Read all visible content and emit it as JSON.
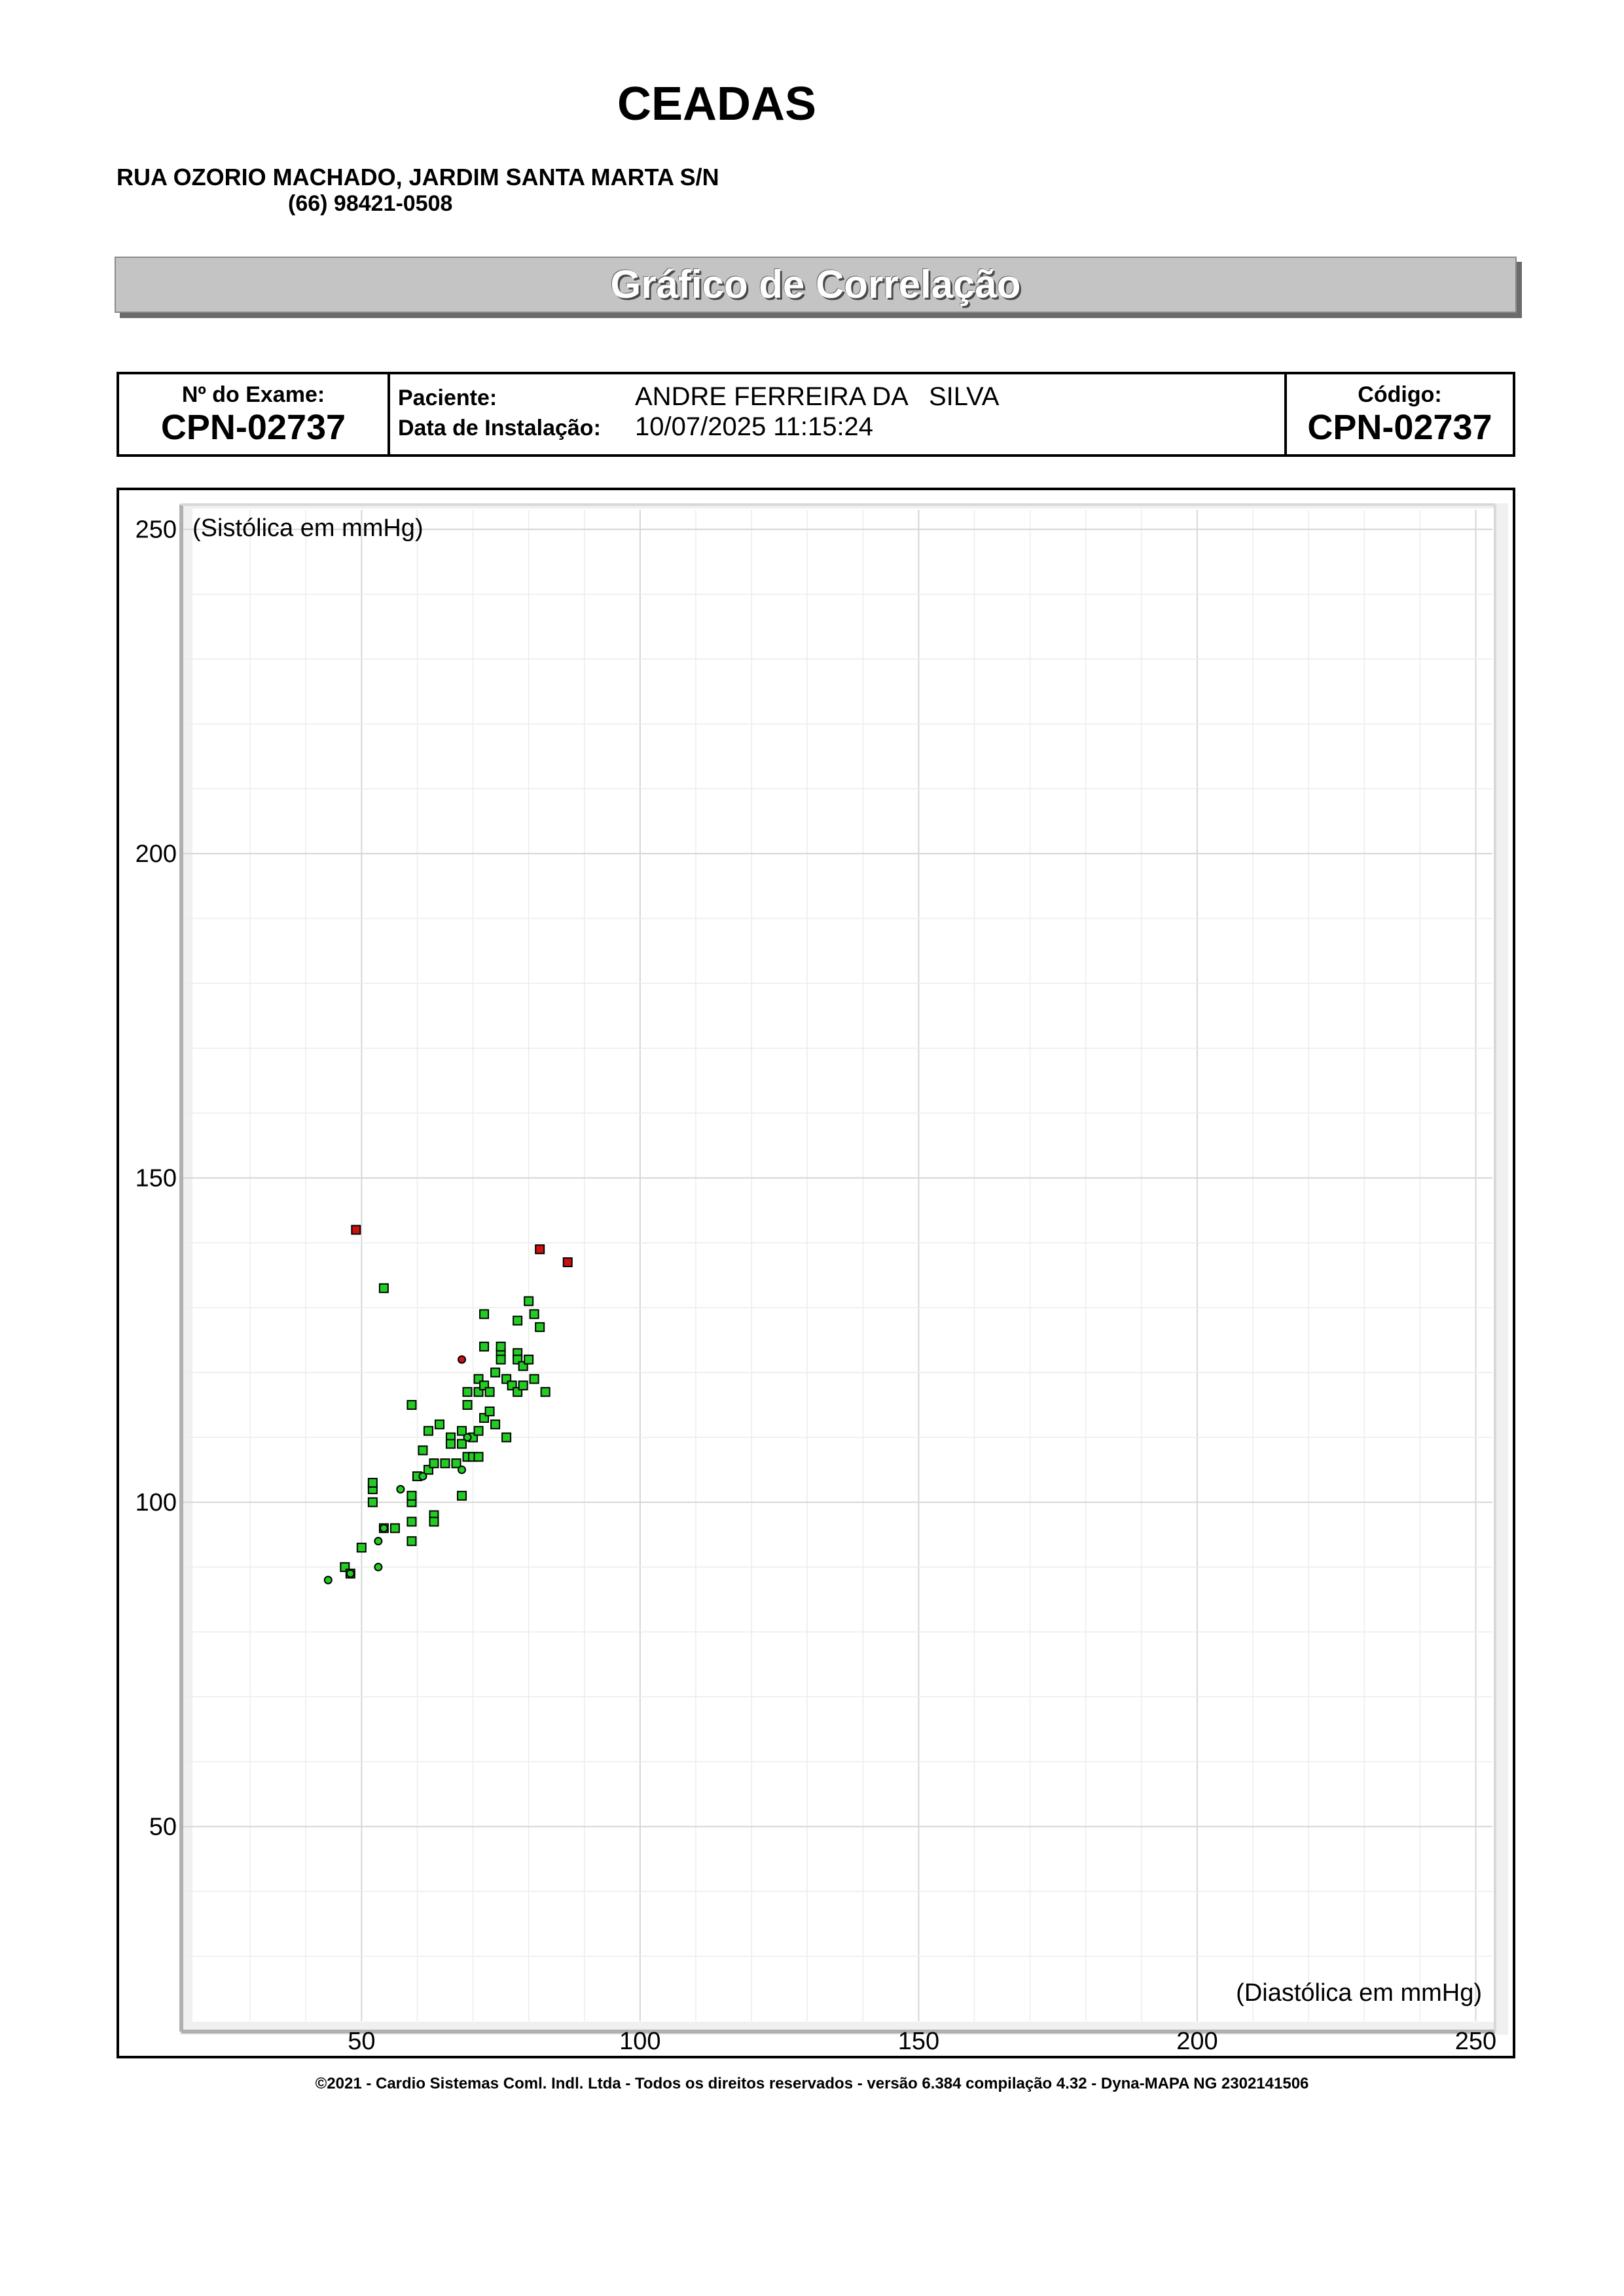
{
  "header": {
    "clinic_name": "CEADAS",
    "address": "RUA OZORIO MACHADO, JARDIM SANTA MARTA S/N",
    "phone": "(66) 98421-0508"
  },
  "banner": {
    "title": "Gráfico de Correlação"
  },
  "info": {
    "exam_label": "Nº do Exame:",
    "exam_value": "CPN-02737",
    "patient_label": "Paciente:",
    "patient_value": "ANDRE FERREIRA DA   SILVA",
    "install_label": "Data de Instalação:",
    "install_value": "10/07/2025 11:15:24",
    "code_label": "Código:",
    "code_value": "CPN-02737"
  },
  "chart_data": {
    "type": "scatter",
    "xlabel": "(Diastólica em mmHg)",
    "ylabel": "(Sistólica em mmHg)",
    "xlim": [
      18,
      253
    ],
    "ylim": [
      20,
      253
    ],
    "xticks": [
      50,
      100,
      150,
      200,
      250
    ],
    "yticks": [
      50,
      100,
      150,
      200,
      250
    ],
    "grid": true,
    "colors": {
      "normal": "#22cc22",
      "alert": "#cc1111",
      "grid": "#dddddd",
      "frame": "#b0b0b0"
    },
    "series": [
      {
        "marker": "square",
        "color": "#22cc22",
        "points": [
          [
            47,
            90
          ],
          [
            48,
            89
          ],
          [
            50,
            93
          ],
          [
            52,
            100
          ],
          [
            52,
            102
          ],
          [
            52,
            103
          ],
          [
            54,
            133
          ],
          [
            54,
            96
          ],
          [
            56,
            96
          ],
          [
            59,
            94
          ],
          [
            59,
            97
          ],
          [
            59,
            100
          ],
          [
            59,
            101
          ],
          [
            59,
            115
          ],
          [
            60,
            104
          ],
          [
            61,
            108
          ],
          [
            62,
            111
          ],
          [
            62,
            105
          ],
          [
            63,
            98
          ],
          [
            63,
            97
          ],
          [
            63,
            106
          ],
          [
            64,
            112
          ],
          [
            65,
            106
          ],
          [
            66,
            110
          ],
          [
            66,
            109
          ],
          [
            67,
            106
          ],
          [
            68,
            111
          ],
          [
            68,
            109
          ],
          [
            68,
            101
          ],
          [
            69,
            117
          ],
          [
            69,
            115
          ],
          [
            69,
            107
          ],
          [
            70,
            110
          ],
          [
            70,
            107
          ],
          [
            71,
            119
          ],
          [
            71,
            117
          ],
          [
            71,
            111
          ],
          [
            71,
            107
          ],
          [
            72,
            129
          ],
          [
            72,
            124
          ],
          [
            72,
            118
          ],
          [
            72,
            113
          ],
          [
            73,
            117
          ],
          [
            73,
            114
          ],
          [
            74,
            120
          ],
          [
            74,
            112
          ],
          [
            75,
            123
          ],
          [
            75,
            124
          ],
          [
            75,
            122
          ],
          [
            76,
            110
          ],
          [
            76,
            119
          ],
          [
            77,
            118
          ],
          [
            78,
            128
          ],
          [
            78,
            123
          ],
          [
            78,
            122
          ],
          [
            78,
            117
          ],
          [
            79,
            121
          ],
          [
            79,
            118
          ],
          [
            80,
            131
          ],
          [
            80,
            122
          ],
          [
            81,
            129
          ],
          [
            81,
            119
          ],
          [
            82,
            127
          ],
          [
            83,
            117
          ]
        ]
      },
      {
        "marker": "circle",
        "color": "#22cc22",
        "points": [
          [
            44,
            88
          ],
          [
            48,
            89
          ],
          [
            53,
            90
          ],
          [
            53,
            94
          ],
          [
            54,
            96
          ],
          [
            57,
            102
          ],
          [
            61,
            104
          ],
          [
            68,
            105
          ],
          [
            69,
            110
          ]
        ]
      },
      {
        "marker": "square",
        "color": "#cc1111",
        "points": [
          [
            49,
            142
          ],
          [
            82,
            139
          ],
          [
            87,
            137
          ]
        ]
      },
      {
        "marker": "circle",
        "color": "#cc1111",
        "points": [
          [
            68,
            122
          ]
        ]
      }
    ]
  },
  "footer": {
    "text": "©2021 - Cardio Sistemas Coml. Indl. Ltda - Todos os direitos reservados - versão 6.384 compilação 4.32 - Dyna-MAPA NG 2302141506"
  }
}
